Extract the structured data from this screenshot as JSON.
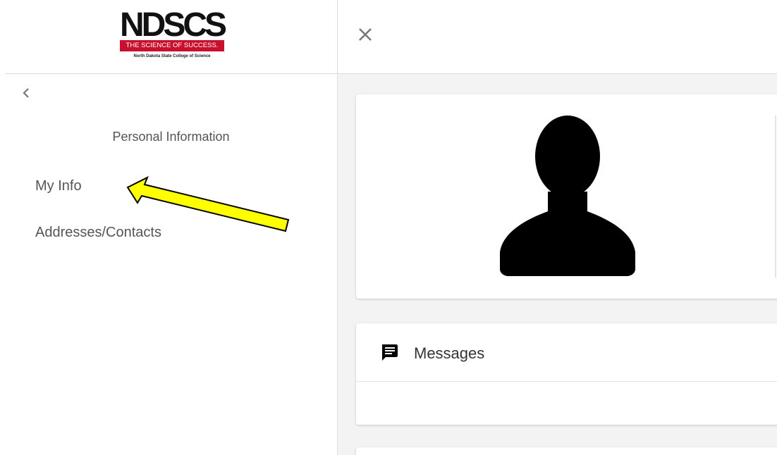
{
  "logo": {
    "wordmark": "NDSCS",
    "tagline": "THE SCIENCE OF SUCCESS.",
    "subtitle": "North Dakota State College of Science"
  },
  "sidebar": {
    "collapse_icon": "chevron-left-icon",
    "section_title": "Personal Information",
    "items": [
      {
        "label": "My Info"
      },
      {
        "label": "Addresses/Contacts"
      }
    ]
  },
  "main": {
    "close_icon": "close-icon",
    "profile": {
      "avatar_icon": "user-silhouette-icon"
    },
    "messages": {
      "icon": "message-icon",
      "title": "Messages"
    }
  },
  "annotation": {
    "arrow_color": "#ffff00",
    "arrow_outline": "#000000",
    "points_to": "My Info"
  },
  "colors": {
    "brand_red": "#c8102e",
    "sidebar_text": "#555555",
    "main_background": "#f3f3f3"
  }
}
